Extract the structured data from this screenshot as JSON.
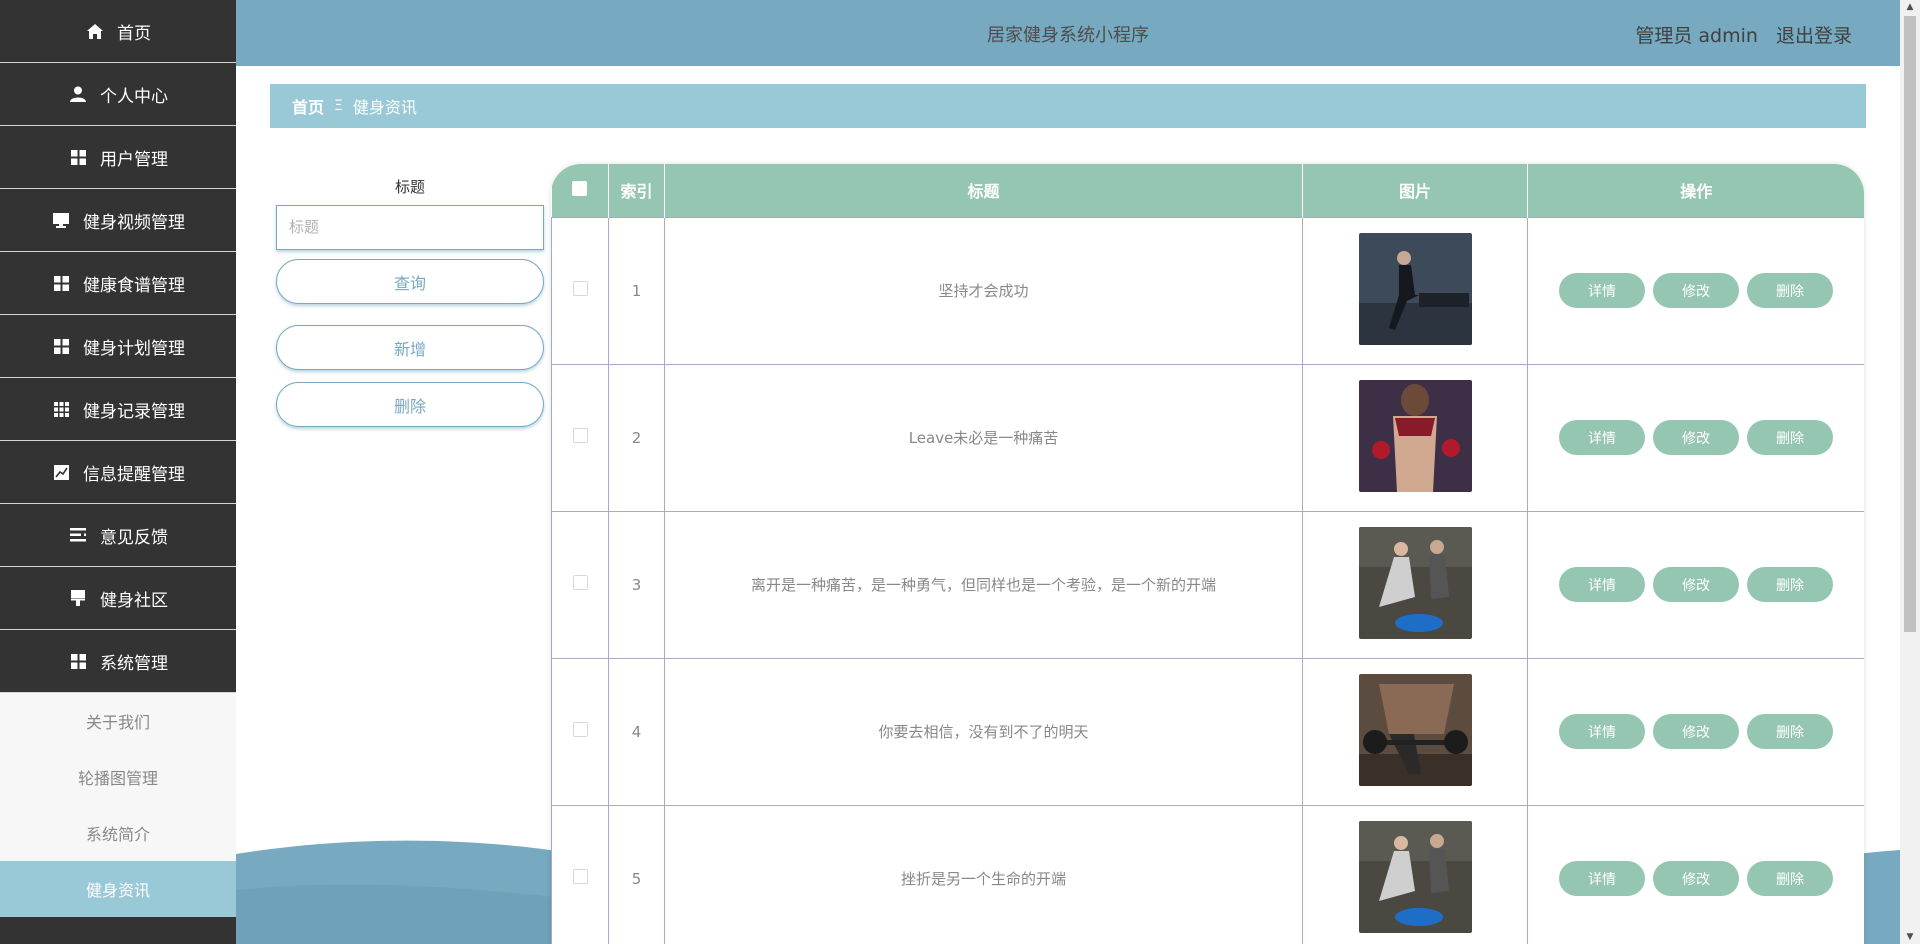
{
  "app": {
    "title": "居家健身系统小程序"
  },
  "header": {
    "user_label": "管理员 admin",
    "logout_label": "退出登录"
  },
  "sidebar": {
    "items": [
      {
        "label": "首页",
        "icon": "home-icon"
      },
      {
        "label": "个人中心",
        "icon": "user-icon"
      },
      {
        "label": "用户管理",
        "icon": "grid-icon"
      },
      {
        "label": "健身视频管理",
        "icon": "monitor-icon"
      },
      {
        "label": "健康食谱管理",
        "icon": "grid-icon"
      },
      {
        "label": "健身计划管理",
        "icon": "grid-icon"
      },
      {
        "label": "健身记录管理",
        "icon": "grid9-icon"
      },
      {
        "label": "信息提醒管理",
        "icon": "chart-icon"
      },
      {
        "label": "意见反馈",
        "icon": "list-icon"
      },
      {
        "label": "健身社区",
        "icon": "paint-icon"
      },
      {
        "label": "系统管理",
        "icon": "grid-icon"
      }
    ],
    "subitems": [
      {
        "label": "关于我们"
      },
      {
        "label": "轮播图管理"
      },
      {
        "label": "系统简介"
      },
      {
        "label": "健身资讯",
        "active": true
      }
    ]
  },
  "breadcrumb": {
    "home": "首页",
    "separator": "Ξ",
    "current": "健身资讯"
  },
  "search": {
    "label": "标题",
    "placeholder": "标题",
    "value": "",
    "search_button": "查询",
    "add_button": "新增",
    "delete_button": "删除"
  },
  "table": {
    "headers": {
      "index": "索引",
      "title": "标题",
      "image": "图片",
      "actions": "操作"
    },
    "action_labels": {
      "detail": "详情",
      "edit": "修改",
      "delete": "删除"
    },
    "rows": [
      {
        "index": "1",
        "title": "坚持才会成功"
      },
      {
        "index": "2",
        "title": "Leave未必是一种痛苦"
      },
      {
        "index": "3",
        "title": "离开是一种痛苦，是一种勇气，但同样也是一个考验，是一个新的开端"
      },
      {
        "index": "4",
        "title": "你要去相信，没有到不了的明天"
      },
      {
        "index": "5",
        "title": "挫折是另一个生命的开端"
      }
    ]
  },
  "colors": {
    "sidebar_bg": "#333333",
    "header_bg": "#77a9c1",
    "accent": "#99c8d6",
    "table_head": "#95c6b1",
    "button": "#95c6b1"
  }
}
